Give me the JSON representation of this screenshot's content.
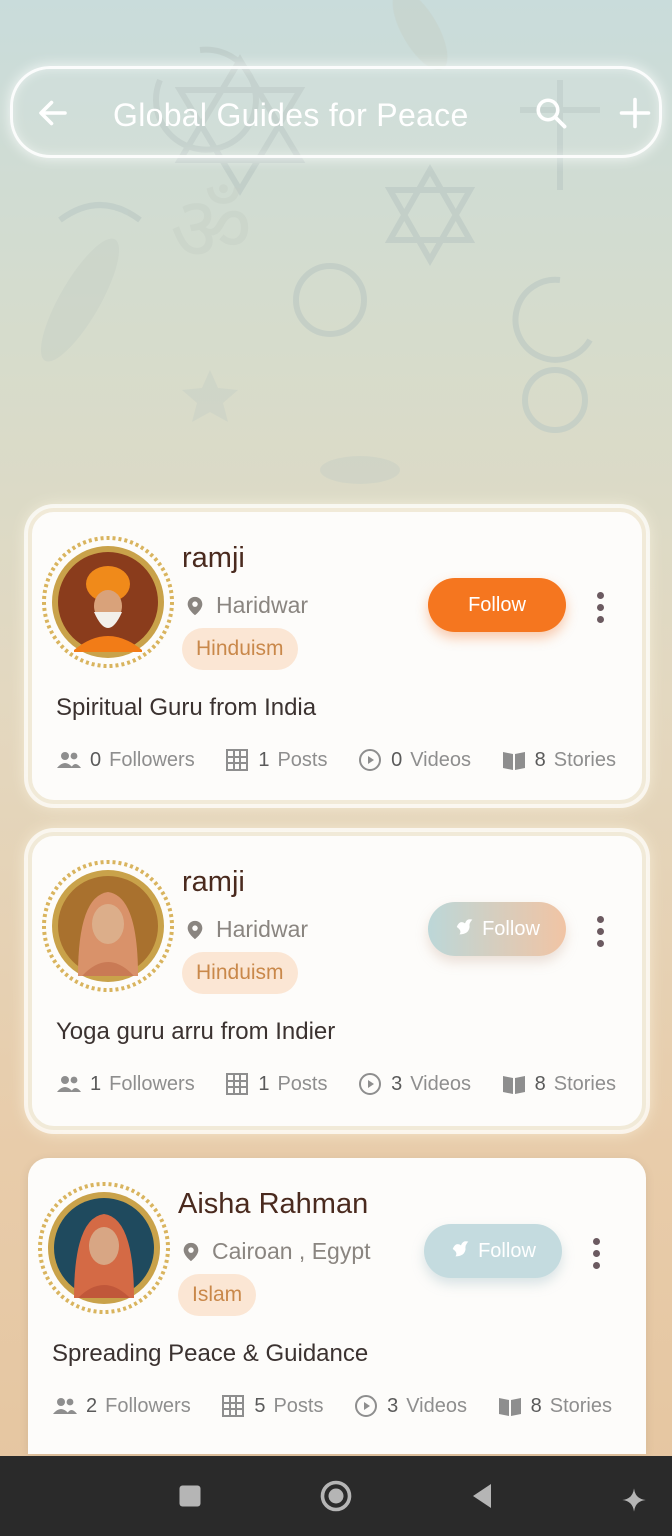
{
  "header": {
    "title": "Global Guides for Peace"
  },
  "cards": [
    {
      "name": "ramji",
      "location": "Haridwar",
      "tag": "Hinduism",
      "follow_label": "Follow",
      "bio": "Spiritual Guru from India",
      "stats": {
        "followers": "0",
        "followers_label": "Followers",
        "posts": "1",
        "posts_label": "Posts",
        "videos": "0",
        "videos_label": "Videos",
        "stories": "8",
        "stories_label": "Stories"
      }
    },
    {
      "name": "ramji",
      "location": "Haridwar",
      "tag": "Hinduism",
      "follow_label": "Follow",
      "bio": "Yoga guru arru from Indier",
      "stats": {
        "followers": "1",
        "followers_label": "Followers",
        "posts": "1",
        "posts_label": "Posts",
        "videos": "3",
        "videos_label": "Videos",
        "stories": "8",
        "stories_label": "Stories"
      }
    },
    {
      "name": "Aisha Rahman",
      "location": "Cairoan , Egypt",
      "tag": "Islam",
      "follow_label": "Follow",
      "bio": "Spreading Peace & Guidance",
      "stats": {
        "followers": "2",
        "followers_label": "Followers",
        "posts": "5",
        "posts_label": "Posts",
        "videos": "3",
        "videos_label": "Videos",
        "stories": "8",
        "stories_label": "Stories"
      }
    }
  ],
  "colors": {
    "follow_active": "#f5761f",
    "tag_bg": "#fbe6d4",
    "tag_text": "#c9884a",
    "name": "#4a2a1e"
  }
}
